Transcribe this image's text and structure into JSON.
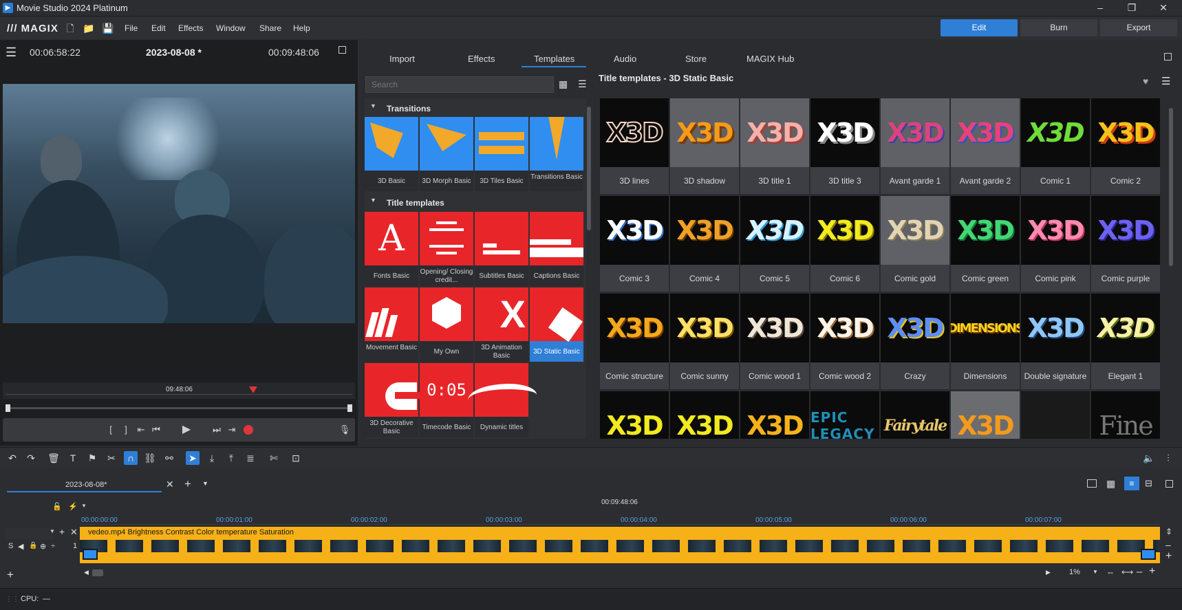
{
  "window": {
    "title": "Movie Studio 2024 Platinum"
  },
  "menubar": {
    "logo": "MAGIX",
    "menus": [
      "File",
      "Edit",
      "Effects",
      "Window",
      "Share",
      "Help"
    ],
    "modes": [
      "Edit",
      "Burn",
      "Export"
    ]
  },
  "preview": {
    "time_left": "00:06:58:22",
    "project": "2023-08-08 *",
    "time_right": "00:09:48:06",
    "scrub_time": "09:48:06"
  },
  "media_tabs": [
    "Import",
    "Effects",
    "Templates",
    "Audio",
    "Store",
    "MAGIX Hub"
  ],
  "search": {
    "placeholder": "Search"
  },
  "categories": {
    "transitions_title": "Transitions",
    "transitions": [
      "3D Basic",
      "3D Morph Basic",
      "3D Tiles Basic",
      "Transitions Basic"
    ],
    "titles_title": "Title templates",
    "titles": [
      "Fonts Basic",
      "Opening/ Closing credit...",
      "Subtitles Basic",
      "Captions Basic",
      "Movement Basic",
      "My Own",
      "3D Animation Basic",
      "3D Static Basic",
      "3D Decorative Basic",
      "Timecode Basic",
      "Dynamic titles"
    ]
  },
  "grid": {
    "heading": "Title templates - 3D Static Basic",
    "items": [
      "3D lines",
      "3D shadow",
      "3D title 1",
      "3D title 3",
      "Avant garde 1",
      "Avant garde 2",
      "Comic 1",
      "Comic 2",
      "Comic 3",
      "Comic 4",
      "Comic 5",
      "Comic 6",
      "Comic gold",
      "Comic green",
      "Comic pink",
      "Comic purple",
      "Comic structure",
      "Comic sunny",
      "Comic wood 1",
      "Comic wood 2",
      "Crazy",
      "Dimensions",
      "Double signature",
      "Elegant 1"
    ],
    "thumb_text": "X3D",
    "thumb_dimensions": "DIMENSIONS",
    "row4_texts": [
      "X3D",
      "X3D",
      "X3D",
      "EPIC LEGACY",
      "Fairytale",
      "X3D",
      "",
      "Fine"
    ]
  },
  "timeline": {
    "tab": "2023-08-08*",
    "marker_time": "00:09:48:06",
    "ticks": [
      "00:00:00:00",
      "00:00:01:00",
      "00:00:02:00",
      "00:00:03:00",
      "00:00:04:00",
      "00:00:05:00",
      "00:00:06:00",
      "00:00:07:00"
    ],
    "track_label": "vedeo.mp4  Brightness  Contrast  Color temperature  Saturation",
    "track_number": "1",
    "track_s": "S",
    "zoom": "1%"
  },
  "status": {
    "cpu_label": "CPU:",
    "cpu_value": "—"
  },
  "colors": {
    "accent": "#2f7fd6",
    "track": "#f6b018",
    "red_tile": "#e8262a",
    "blue_tile": "#2f8ef0",
    "orange": "#f2a828"
  }
}
